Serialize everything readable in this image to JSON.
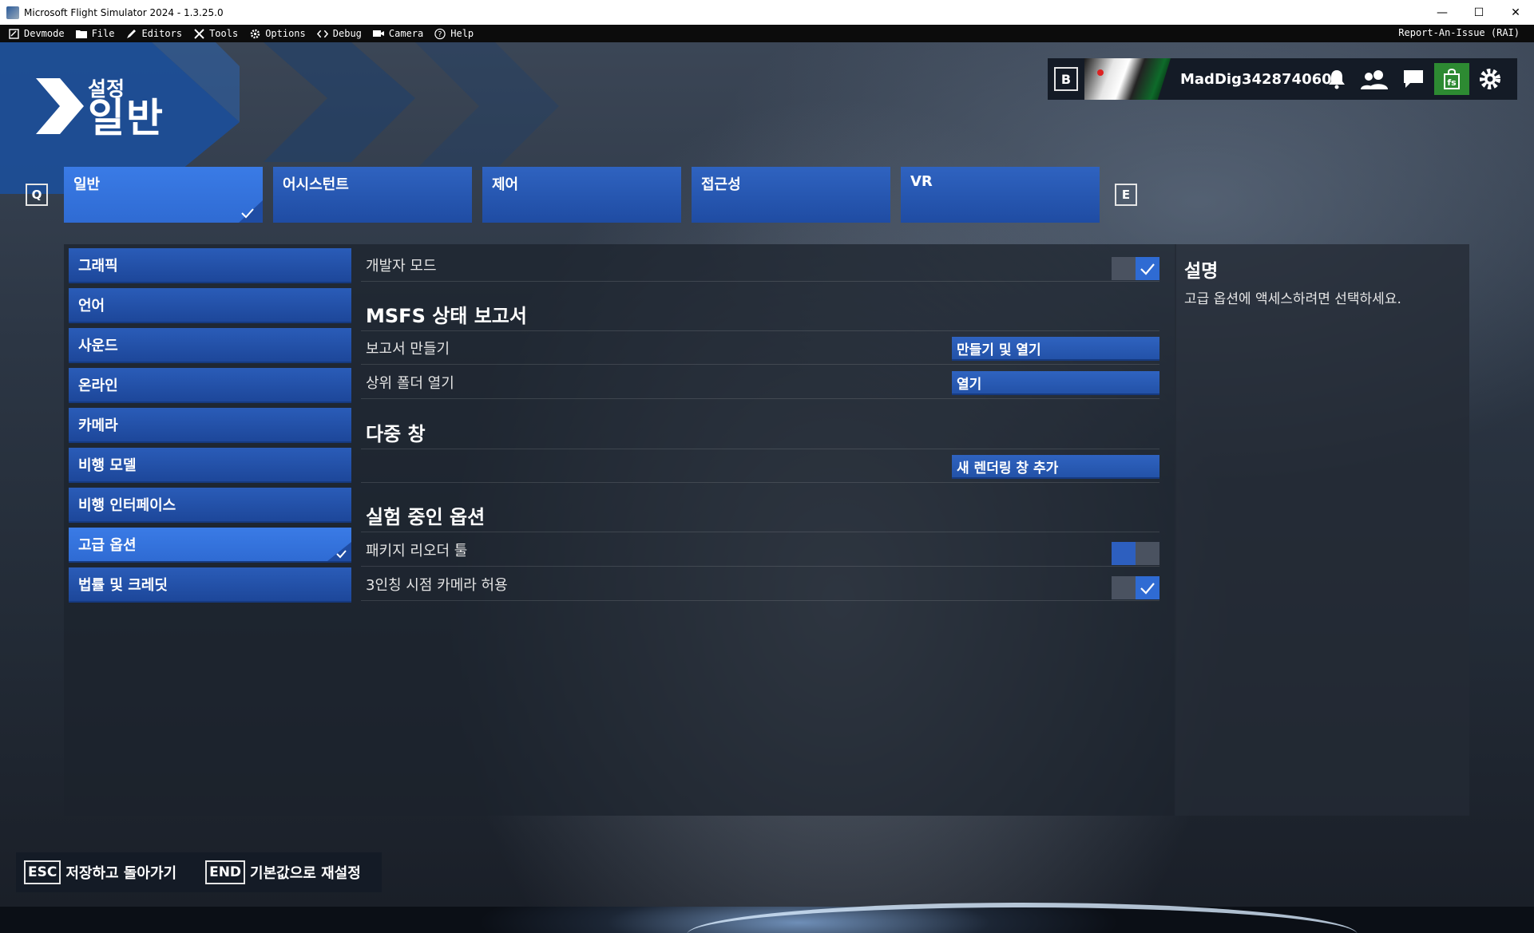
{
  "window": {
    "title": "Microsoft Flight Simulator 2024 - 1.3.25.0",
    "minimize": "—",
    "maximize": "☐",
    "close": "✕"
  },
  "devmenu": {
    "items": [
      "Devmode",
      "File",
      "Editors",
      "Tools",
      "Options",
      "Debug",
      "Camera",
      "Help"
    ],
    "report": "Report-An-Issue (RAI)"
  },
  "header": {
    "subtitle": "설정",
    "title": "일반"
  },
  "user": {
    "key": "B",
    "name": "MadDig342874060"
  },
  "tabs": {
    "prev_key": "Q",
    "next_key": "E",
    "items": [
      "일반",
      "어시스턴트",
      "제어",
      "접근성",
      "VR"
    ],
    "active": "일반"
  },
  "sidebar": {
    "items": [
      "그래픽",
      "언어",
      "사운드",
      "온라인",
      "카메라",
      "비행 모델",
      "비행 인터페이스",
      "고급 옵션",
      "법률 및 크레딧"
    ],
    "active": "고급 옵션"
  },
  "settings": {
    "dev_mode_label": "개발자 모드",
    "dev_mode_value": "on",
    "section_msfs": "MSFS 상태 보고서",
    "report_create_label": "보고서 만들기",
    "report_create_button": "만들기 및 열기",
    "open_parent_label": "상위 폴더 열기",
    "open_parent_button": "열기",
    "section_multi": "다중 창",
    "add_window_button": "새 렌더링 창 추가",
    "section_experimental": "실험 중인 옵션",
    "package_reorder_label": "패키지 리오더 툴",
    "package_reorder_value": "off",
    "third_person_label": "3인칭 시점 카메라 허용",
    "third_person_value": "on"
  },
  "description": {
    "title": "설명",
    "text": "고급 옵션에 액세스하려면 선택하세요."
  },
  "footer": {
    "esc_key": "ESC",
    "esc_label": "저장하고 돌아가기",
    "end_key": "END",
    "end_label": "기본값으로 재설정"
  },
  "colors": {
    "accent": "#2f6bd3",
    "button": "#2352a8",
    "store_green": "#2d8a32"
  }
}
